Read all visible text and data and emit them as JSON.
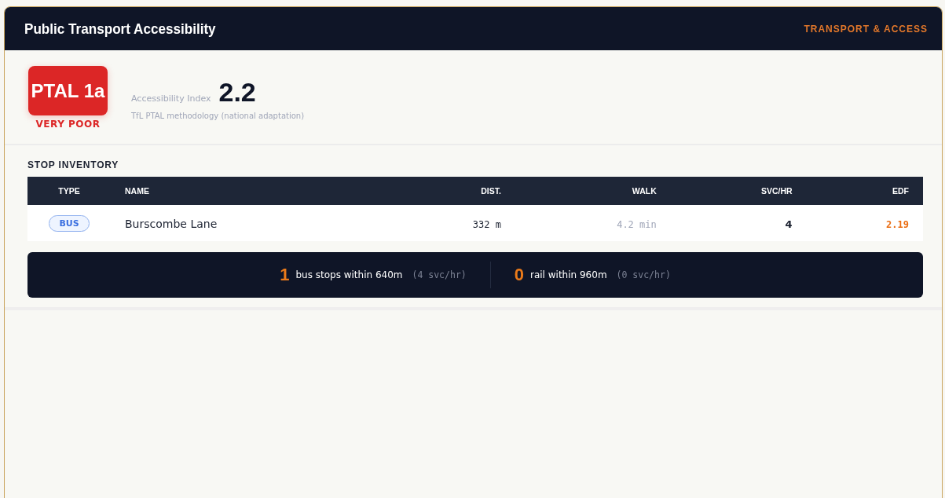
{
  "header": {
    "title": "Public Transport Accessibility",
    "tag": "TRANSPORT & ACCESS"
  },
  "rating": {
    "badge": "PTAL 1a",
    "grade": "VERY POOR",
    "index_label": "Accessibility Index",
    "index_value": "2.2",
    "methodology": "TfL PTAL methodology (national adaptation)"
  },
  "stop_inventory": {
    "title": "STOP INVENTORY",
    "columns": [
      "TYPE",
      "NAME",
      "DIST.",
      "WALK",
      "SVC/HR",
      "EDF"
    ],
    "rows": [
      {
        "type": "BUS",
        "kind": "bus",
        "name": "Burscombe Lane",
        "dist": "332 m",
        "walk": "4.2 min",
        "svc_hr": "4",
        "edf": "2.19"
      }
    ]
  },
  "summary": [
    {
      "count": "1",
      "label": "bus stops within 640m",
      "detail": "(4 svc/hr)"
    },
    {
      "count": "0",
      "label": "rail within 960m",
      "detail": "(0 svc/hr)"
    }
  ]
}
